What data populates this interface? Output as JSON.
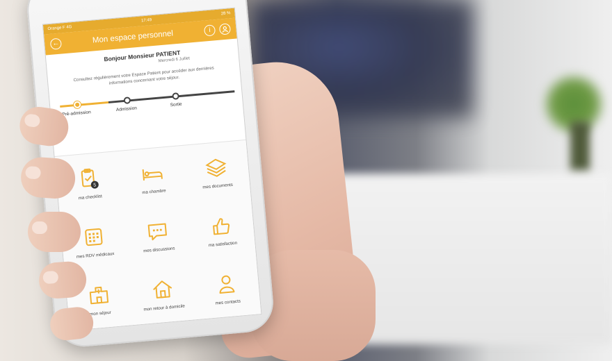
{
  "status_bar": {
    "carrier": "Orange F  4G",
    "time": "17:49",
    "battery": "28 %"
  },
  "header": {
    "title": "Mon espace personnel",
    "info_icon": "info-icon",
    "profile_icon": "user-circle-icon",
    "back_icon": "back-arrow-icon"
  },
  "greeting": {
    "hello": "Bonjour Monsieur PATIENT",
    "date": "Mercredi 6 Juillet"
  },
  "info_text": "Consultez régulièrement votre Espace Patient pour accéder aux dernières informations concernant votre séjour.",
  "progress": {
    "steps": [
      "Pré-admission",
      "Admission",
      "Sortie"
    ],
    "current_step": 1
  },
  "menu": {
    "items": [
      {
        "label": "ma checklist",
        "icon": "checklist-icon",
        "badge": "5"
      },
      {
        "label": "ma chambre",
        "icon": "bed-icon"
      },
      {
        "label": "mes documents",
        "icon": "layers-icon"
      },
      {
        "label": "mes RDV médicaux",
        "icon": "calendar-icon"
      },
      {
        "label": "mes discussions",
        "icon": "chat-icon"
      },
      {
        "label": "ma satisfaction",
        "icon": "thumbs-up-icon"
      },
      {
        "label": "mon séjour",
        "icon": "hospital-icon"
      },
      {
        "label": "mon retour à domicile",
        "icon": "home-icon"
      },
      {
        "label": "mes contacts",
        "icon": "contact-icon"
      }
    ]
  },
  "colors": {
    "accent": "#f0b133",
    "accent_dark": "#e6ab2e",
    "track": "#444444"
  }
}
